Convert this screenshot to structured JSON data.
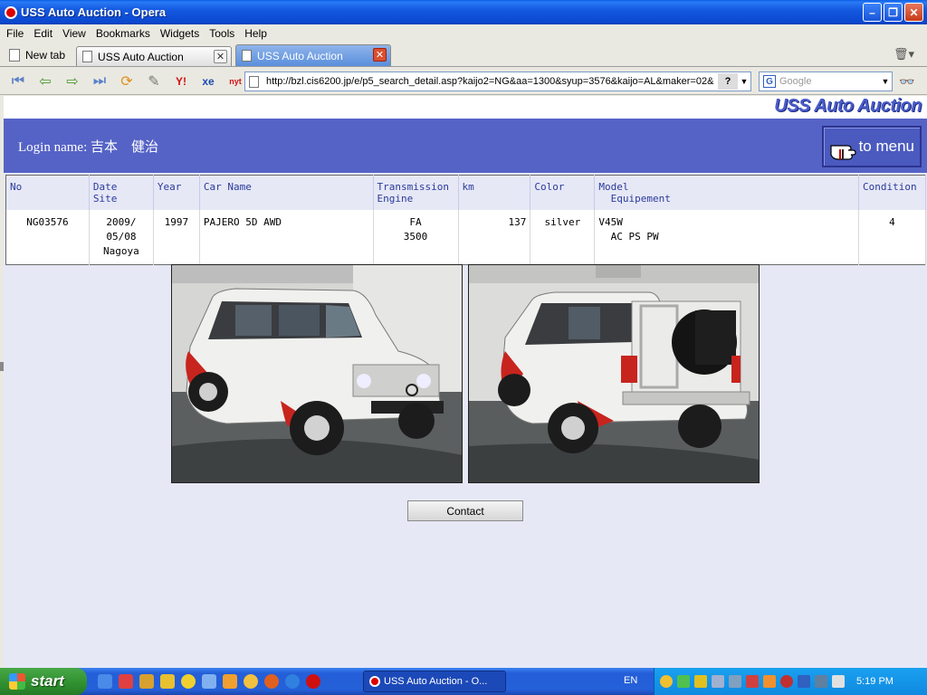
{
  "window": {
    "title": "USS Auto Auction - Opera"
  },
  "menubar": [
    "File",
    "Edit",
    "View",
    "Bookmarks",
    "Widgets",
    "Tools",
    "Help"
  ],
  "tabs": {
    "new_tab_label": "New tab",
    "items": [
      "USS Auto Auction",
      "USS Auto Auction"
    ]
  },
  "address": {
    "url": "http://bzl.cis6200.jp/e/p5_search_detail.asp?kaijo2=NG&aa=1300&syup=3576&kaijo=AL&maker=02&"
  },
  "search": {
    "placeholder": "Google"
  },
  "page": {
    "logo": "USS Auto Auction",
    "login_label": "Login name: 吉本　健治",
    "menu_button": "to menu",
    "headers": {
      "no": "No",
      "date": "Date",
      "site": "Site",
      "year": "Year",
      "car_name": "Car Name",
      "transmission": "Transmission",
      "engine": "Engine",
      "km": "km",
      "color": "Color",
      "model": "Model",
      "equipment": "Equipement",
      "condition": "Condition"
    },
    "row": {
      "no": "NG03576",
      "date_line1": "2009/",
      "date_line2": "05/08",
      "site": "Nagoya",
      "year": "1997",
      "car_name": "PAJERO 5D AWD",
      "transmission": "FA",
      "engine": "3500",
      "km": "137",
      "color": "silver",
      "model": "V45W",
      "equipment": "AC PS PW",
      "condition": "4"
    },
    "contact_button": "Contact"
  },
  "taskbar": {
    "start_label": "start",
    "task_label": "USS Auto Auction - O...",
    "language": "EN",
    "clock": "5:19 PM"
  }
}
